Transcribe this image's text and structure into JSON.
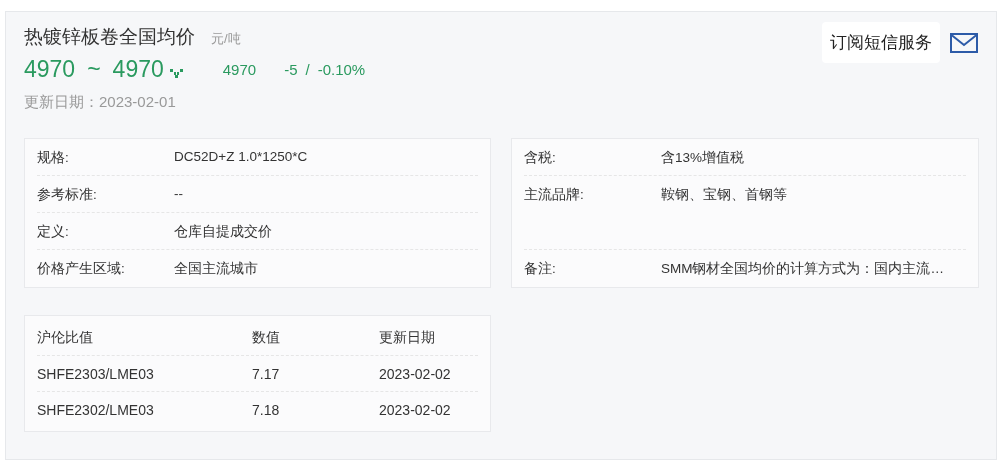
{
  "header": {
    "title": "热镀锌板卷全国均价",
    "unit": "元/吨",
    "price_low": "4970",
    "separator": "~",
    "price_high": "4970",
    "avg": "4970",
    "change": "-5",
    "change_separator": "/",
    "change_pct": "-0.10%",
    "date_label": "更新日期：",
    "date": "2023-02-01",
    "subscribe": "订阅短信服务"
  },
  "spec_left": [
    {
      "label": "规格:",
      "value": "DC52D+Z 1.0*1250*C"
    },
    {
      "label": "参考标准:",
      "value": "--"
    },
    {
      "label": "定义:",
      "value": "仓库自提成交价"
    },
    {
      "label": "价格产生区域:",
      "value": "全国主流城市"
    }
  ],
  "spec_right": [
    {
      "label": "含税:",
      "value": "含13%增值税",
      "tall": false
    },
    {
      "label": "主流品牌:",
      "value": "鞍钢、宝钢、首钢等",
      "tall": true
    },
    {
      "label": "备注:",
      "value": "SMM钢材全国均价的计算方式为：国内主流…",
      "tall": false
    }
  ],
  "ratio_table": {
    "columns": [
      "沪伦比值",
      "数值",
      "更新日期"
    ],
    "rows": [
      [
        "SHFE2303/LME03",
        "7.17",
        "2023-02-02"
      ],
      [
        "SHFE2302/LME03",
        "7.18",
        "2023-02-02"
      ]
    ]
  }
}
